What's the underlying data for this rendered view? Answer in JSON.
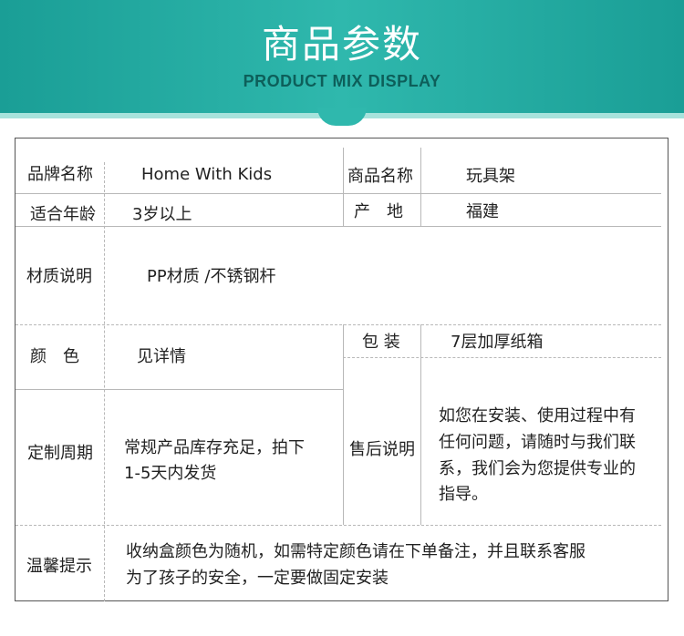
{
  "banner": {
    "title": "商品参数",
    "subtitle": "PRODUCT MIX DISPLAY"
  },
  "table": {
    "brand_label": "品牌名称",
    "brand_value": "Home With Kids",
    "product_label": "商品名称",
    "product_value": "玩具架",
    "age_label": "适合年龄",
    "age_value": "3岁以上",
    "origin_label": "产　地",
    "origin_value": "福建",
    "material_label": "材质说明",
    "material_value": "PP材质 /不锈钢杆",
    "color_label": "颜　色",
    "color_value": "见详情",
    "package_label": "包 装",
    "package_value": "7层加厚纸箱",
    "cycle_label": "定制周期",
    "cycle_value_line1": "常规产品库存充足，拍下",
    "cycle_value_line2": "1-5天内发货",
    "aftersale_label": "售后说明",
    "aftersale_line1": "如您在安装、使用过程中有",
    "aftersale_line2": "任何问题，请随时与我们联",
    "aftersale_line3": "系，我们会为您提供专业的",
    "aftersale_line4": "指导。",
    "tips_label": "温馨提示",
    "tips_line1": "收纳盒颜色为随机，如需特定颜色请在下单备注，并且联系客服",
    "tips_line2": "为了孩子的安全，一定要做固定安装"
  }
}
